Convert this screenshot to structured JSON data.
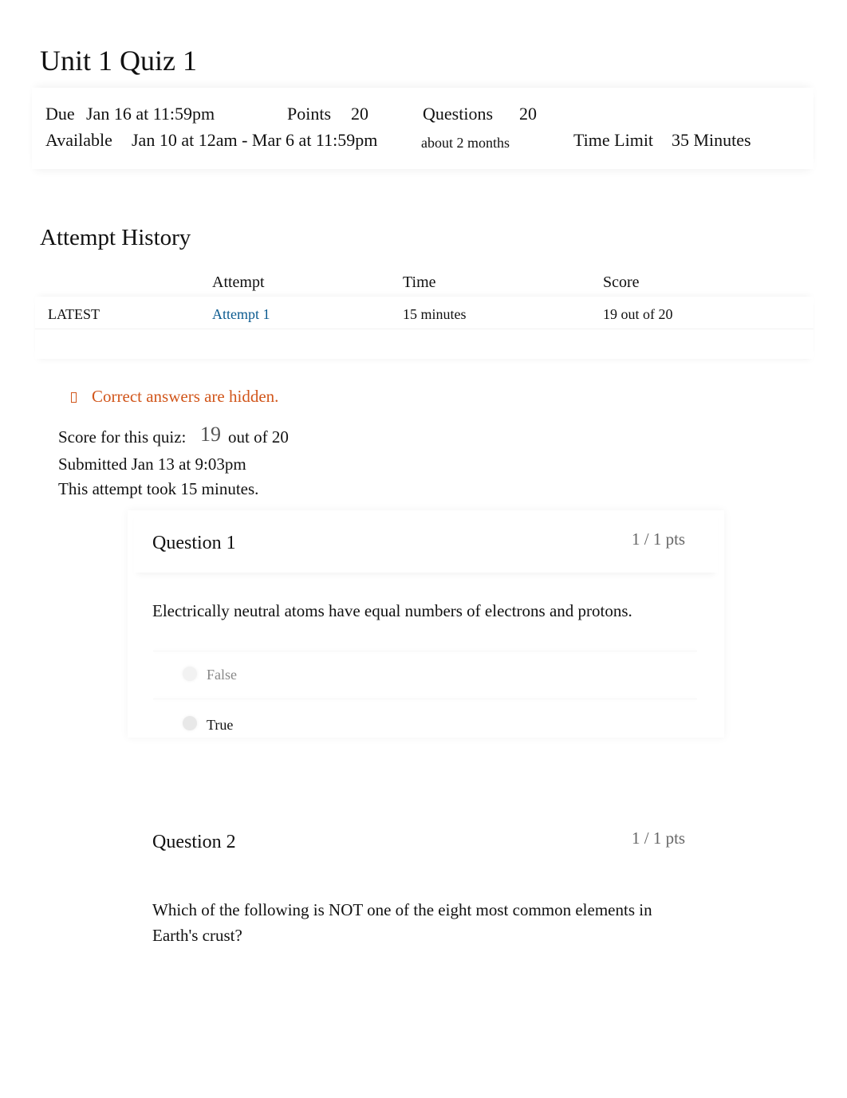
{
  "page": {
    "title": "Unit 1 Quiz 1"
  },
  "details": {
    "due_label": "Due",
    "due_value": "Jan 16 at 11:59pm",
    "points_label": "Points",
    "points_value": "20",
    "questions_label": "Questions",
    "questions_value": "20",
    "available_label": "Available",
    "available_value": "Jan 10 at 12am - Mar 6 at 11:59pm",
    "available_duration": "about 2 months",
    "time_limit_label": "Time Limit",
    "time_limit_value": "35 Minutes"
  },
  "attempt_history": {
    "heading": "Attempt History",
    "columns": [
      "",
      "Attempt",
      "Time",
      "Score"
    ],
    "rows": [
      {
        "tag": "LATEST",
        "attempt": "Attempt 1",
        "time": "15 minutes",
        "score": "19 out of 20"
      }
    ]
  },
  "results": {
    "notice_icon": "warning-icon",
    "notice": "Correct answers are hidden.",
    "score_label": "Score for this quiz:",
    "score_value": "19",
    "score_suffix": "out of 20",
    "submitted": "Submitted Jan 13 at 9:03pm",
    "duration": "This attempt took 15 minutes."
  },
  "colors": {
    "link": "#0b5a8f",
    "warning": "#d1561b",
    "muted": "#666666"
  },
  "questions": [
    {
      "title": "Question 1",
      "points": "1 / 1 pts",
      "text": "Electrically neutral atoms have equal numbers of electrons and protons.",
      "answers": [
        {
          "label": "False",
          "selected": false
        },
        {
          "label": "True",
          "selected": true
        }
      ]
    },
    {
      "title": "Question 2",
      "points": "1 / 1 pts",
      "text": "Which of the following is NOT one of the eight most common elements in Earth's crust?"
    }
  ]
}
